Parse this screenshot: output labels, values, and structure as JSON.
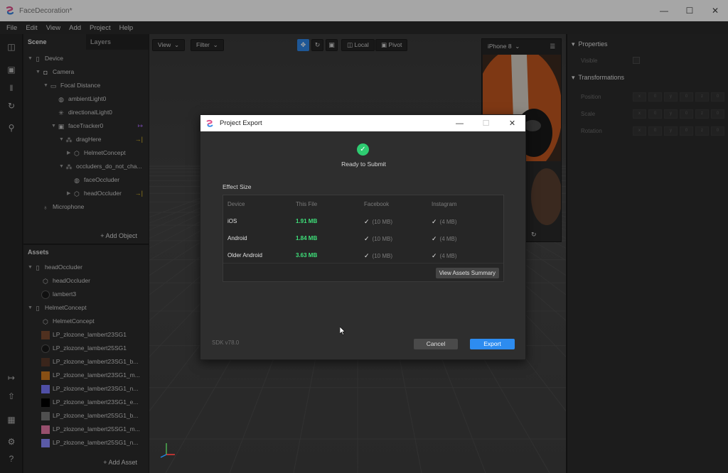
{
  "app": {
    "title": "FaceDecoration*"
  },
  "menu": [
    "File",
    "Edit",
    "View",
    "Add",
    "Project",
    "Help"
  ],
  "scene": {
    "tabs": [
      "Scene",
      "Layers"
    ],
    "tree": [
      {
        "label": "Device",
        "icon": "device-icon",
        "indent": 0,
        "expander": "down"
      },
      {
        "label": "Camera",
        "icon": "camera-icon",
        "indent": 1,
        "expander": "down"
      },
      {
        "label": "Focal Distance",
        "icon": "focal-distance-icon",
        "indent": 2,
        "expander": "down"
      },
      {
        "label": "ambientLight0",
        "icon": "ambient-light-icon",
        "indent": 3,
        "expander": "none"
      },
      {
        "label": "directionalLight0",
        "icon": "directional-light-icon",
        "indent": 3,
        "expander": "none"
      },
      {
        "label": "faceTracker0",
        "icon": "face-tracker-icon",
        "indent": 3,
        "expander": "down",
        "tag": "↦",
        "tag_color": "#b06cff"
      },
      {
        "label": "dragHere",
        "icon": "null-object-icon",
        "indent": 4,
        "expander": "down",
        "tag": "→|",
        "tag_color": "#e6c229"
      },
      {
        "label": "HelmetConcept",
        "icon": "mesh-icon",
        "indent": 5,
        "expander": "right"
      },
      {
        "label": "occluders_do_not_cha...",
        "icon": "null-object-icon",
        "indent": 4,
        "expander": "down"
      },
      {
        "label": "faceOccluder",
        "icon": "face-mesh-icon",
        "indent": 5,
        "expander": "none"
      },
      {
        "label": "headOccluder",
        "icon": "mesh-icon",
        "indent": 5,
        "expander": "right",
        "tag": "→|",
        "tag_color": "#e6c229"
      },
      {
        "label": "Microphone",
        "icon": "microphone-icon",
        "indent": 1,
        "expander": "none"
      }
    ],
    "add_object_label": "+ Add Object"
  },
  "assets": {
    "title": "Assets",
    "items": [
      {
        "label": "headOccluder",
        "kind": "folder",
        "indent": 0
      },
      {
        "label": "headOccluder",
        "kind": "mesh",
        "indent": 1
      },
      {
        "label": "lambert3",
        "kind": "material",
        "color": "#1a1a1a",
        "indent": 1
      },
      {
        "label": "HelmetConcept",
        "kind": "folder",
        "indent": 0
      },
      {
        "label": "HelmetConcept",
        "kind": "mesh",
        "indent": 1
      },
      {
        "label": "LP_zlozone_lambert23SG1",
        "kind": "texture",
        "color": "#7a4a30",
        "indent": 1
      },
      {
        "label": "LP_zlozone_lambert25SG1",
        "kind": "material",
        "color": "#1a1a1a",
        "indent": 1
      },
      {
        "label": "LP_zlozone_lambert23SG1_b...",
        "kind": "texture",
        "color": "#5a3a2a",
        "indent": 1
      },
      {
        "label": "LP_zlozone_lambert23SG1_m...",
        "kind": "texture",
        "color": "#d07a20",
        "indent": 1
      },
      {
        "label": "LP_zlozone_lambert23SG1_n...",
        "kind": "texture",
        "color": "#7a7aff",
        "indent": 1
      },
      {
        "label": "LP_zlozone_lambert23SG1_e...",
        "kind": "texture",
        "color": "#000000",
        "indent": 1
      },
      {
        "label": "LP_zlozone_lambert25SG1_b...",
        "kind": "texture",
        "color": "#7a7a7a",
        "indent": 1
      },
      {
        "label": "LP_zlozone_lambert25SG1_m...",
        "kind": "texture",
        "color": "#e87aa8",
        "indent": 1
      },
      {
        "label": "LP_zlozone_lambert25SG1_n...",
        "kind": "texture",
        "color": "#8a8aff",
        "indent": 1
      }
    ],
    "add_asset_label": "+ Add Asset"
  },
  "viewport": {
    "view_label": "View",
    "filter_label": "Filter",
    "local_label": "Local",
    "pivot_label": "Pivot",
    "device_label": "iPhone 8"
  },
  "properties": {
    "title": "Properties",
    "visible_label": "Visible",
    "transformations_title": "Transformations",
    "rows": [
      {
        "label": "Position",
        "fields": [
          "x",
          "0",
          "y",
          "0",
          "z",
          "0"
        ]
      },
      {
        "label": "Scale",
        "fields": [
          "x",
          "0",
          "y",
          "0",
          "z",
          "0"
        ]
      },
      {
        "label": "Rotation",
        "fields": [
          "x",
          "0",
          "y",
          "0",
          "z",
          "0"
        ]
      }
    ]
  },
  "dialog": {
    "title": "Project Export",
    "status": "Ready to Submit",
    "section_label": "Effect Size",
    "columns": [
      "Device",
      "This File",
      "Facebook",
      "Instagram"
    ],
    "rows": [
      {
        "device": "iOS",
        "size": "1.91 MB",
        "facebook": "(10 MB)",
        "instagram": "(4 MB)"
      },
      {
        "device": "Android",
        "size": "1.84 MB",
        "facebook": "(10 MB)",
        "instagram": "(4 MB)"
      },
      {
        "device": "Older Android",
        "size": "3.63 MB",
        "facebook": "(10 MB)",
        "instagram": "(4 MB)"
      }
    ],
    "summary_label": "View Assets Summary",
    "sdk_version": "SDK v78.0",
    "cancel_label": "Cancel",
    "export_label": "Export"
  },
  "colors": {
    "accent": "#2d8cf0",
    "success": "#3ee07a"
  }
}
